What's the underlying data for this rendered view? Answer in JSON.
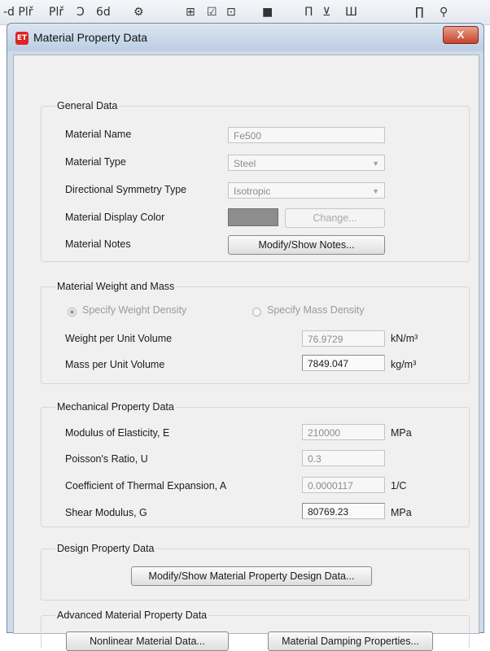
{
  "toolbar": {
    "items": [
      {
        "icon": "text-fragment",
        "label": "-d Plř"
      },
      {
        "icon": "text-fragment",
        "label": "Plř"
      },
      {
        "icon": "undo-icon",
        "label": "Ɔ"
      },
      {
        "icon": "text-fragment",
        "label": "6d"
      },
      {
        "icon": "tool-icon",
        "label": "⚙"
      },
      {
        "icon": "grid-icon",
        "label": "⊞"
      },
      {
        "icon": "check-icon",
        "label": "☑"
      },
      {
        "icon": "box-icon",
        "label": "⊡"
      },
      {
        "icon": "rect-icon",
        "label": "■"
      },
      {
        "icon": "frame-icon",
        "label": "Π"
      },
      {
        "icon": "section-icon",
        "label": "⊻"
      },
      {
        "icon": "bars-icon",
        "label": "Ш"
      },
      {
        "icon": "portal-icon",
        "label": "∏"
      },
      {
        "icon": "node-icon",
        "label": "⚲"
      }
    ]
  },
  "window": {
    "title": "Material Property Data",
    "icon_text": "ET",
    "close_label": "X"
  },
  "general": {
    "heading": "General Data",
    "material_name_label": "Material Name",
    "material_name_value": "Fe500",
    "material_type_label": "Material Type",
    "material_type_value": "Steel",
    "symmetry_label": "Directional Symmetry Type",
    "symmetry_value": "Isotropic",
    "display_color_label": "Material Display Color",
    "display_color": "#8d8d8d",
    "change_label": "Change...",
    "notes_label": "Material Notes",
    "notes_button": "Modify/Show Notes..."
  },
  "weight": {
    "heading": "Material Weight and Mass",
    "option_weight": "Specify Weight Density",
    "option_mass": "Specify Mass Density",
    "weight_label": "Weight per Unit Volume",
    "weight_value": "76.9729",
    "weight_unit": "kN/m³",
    "mass_label": "Mass per Unit Volume",
    "mass_value": "7849.047",
    "mass_unit": "kg/m³"
  },
  "mechanical": {
    "heading": "Mechanical Property Data",
    "e_label": "Modulus of Elasticity,  E",
    "e_value": "210000",
    "e_unit": "MPa",
    "u_label": "Poisson's Ratio,  U",
    "u_value": "0.3",
    "a_label": "Coefficient of Thermal Expansion,  A",
    "a_value": "0.0000117",
    "a_unit": "1/C",
    "g_label": "Shear Modulus,  G",
    "g_value": "80769.23",
    "g_unit": "MPa"
  },
  "design": {
    "heading": "Design Property Data",
    "button": "Modify/Show Material Property Design Data..."
  },
  "advanced": {
    "heading": "Advanced Material Property Data",
    "nonlinear_button": "Nonlinear Material Data...",
    "damping_button": "Material Damping Properties..."
  }
}
